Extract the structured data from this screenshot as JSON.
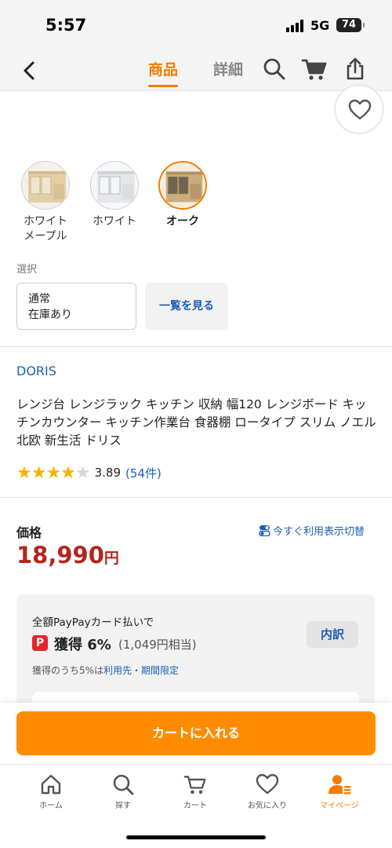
{
  "status_bar": {
    "time": "5:57",
    "network": "5G",
    "battery": "74"
  },
  "header": {
    "tabs": [
      {
        "label": "商品",
        "active": true
      },
      {
        "label": "詳細",
        "active": false
      }
    ],
    "icons": [
      "back-icon",
      "search-icon",
      "cart-icon",
      "share-icon"
    ]
  },
  "favorite": {
    "icon": "heart-icon"
  },
  "variants": [
    {
      "label_line1": "ホワイト",
      "label_line2": "メープル",
      "selected": false
    },
    {
      "label_line1": "ホワイト",
      "label_line2": "",
      "selected": false
    },
    {
      "label_line1": "オーク",
      "label_line2": "",
      "selected": true
    }
  ],
  "options": {
    "section_label": "選択",
    "option_line1": "通常",
    "option_line2": "在庫あり",
    "view_all": "一覧を見る"
  },
  "product": {
    "brand": "DORIS",
    "title": "レンジ台 レンジラック キッチン 収納 幅120 レンジボード キッチンカウンター キッチン作業台 食器棚 ロータイプ スリム ノエル 北欧 新生活 ドリス",
    "rating_value": "3.89",
    "rating_count": "(54件)",
    "rating_stars": 3.89
  },
  "price": {
    "label": "価格",
    "switch_link": "今すぐ利用表示切替",
    "amount": "18,990",
    "unit": "円"
  },
  "paypay": {
    "line1": "全額PayPayカード払いで",
    "logo_letter": "P",
    "earn": "獲得 6%",
    "equivalent": "(1,049円相当)",
    "note_prefix": "獲得のうち5%は",
    "note_link": "利用先・期間限定",
    "breakdown_button": "内訳"
  },
  "cart_button": "カートに入れる",
  "tabbar": [
    {
      "label": "ホーム",
      "icon": "home-icon",
      "active": false
    },
    {
      "label": "探す",
      "icon": "search-icon",
      "active": false
    },
    {
      "label": "カート",
      "icon": "cart-icon",
      "active": false
    },
    {
      "label": "お気に入り",
      "icon": "heart-icon",
      "active": false
    },
    {
      "label": "マイページ",
      "icon": "user-icon",
      "active": true
    }
  ],
  "colors": {
    "accent": "#f57c00",
    "cart_button": "#ff8c00",
    "price": "#b3261e",
    "link": "#1a5fb4",
    "star": "#f6b400"
  }
}
